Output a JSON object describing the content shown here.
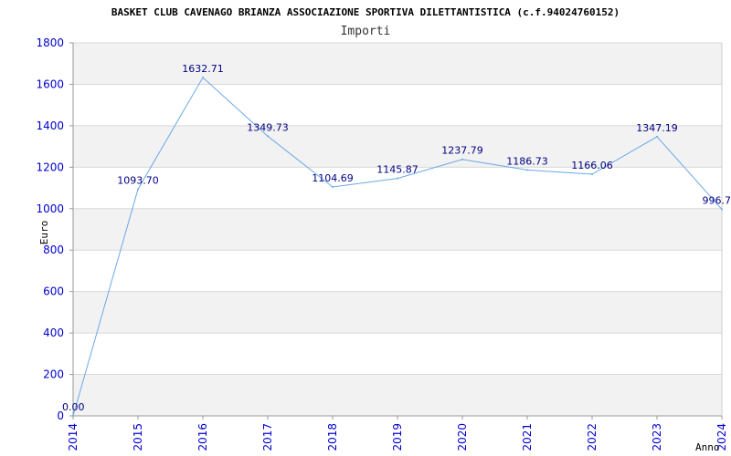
{
  "chart_data": {
    "type": "line",
    "title": "BASKET CLUB CAVENAGO BRIANZA ASSOCIAZIONE SPORTIVA DILETTANTISTICA (c.f.94024760152)",
    "subtitle": "Importi",
    "xlabel": "Anno",
    "ylabel": "Euro",
    "categories": [
      "2014",
      "2015",
      "2016",
      "2017",
      "2018",
      "2019",
      "2020",
      "2021",
      "2022",
      "2023",
      "2024"
    ],
    "series": [
      {
        "values": [
          0,
          1093.7,
          1632.71,
          1349.73,
          1104.69,
          1145.87,
          1237.79,
          1186.73,
          1166.06,
          1347.19,
          996.7
        ],
        "labels": [
          "0.00",
          "1093.70",
          "1632.71",
          "1349.73",
          "1104.69",
          "1145.87",
          "1237.79",
          "1186.73",
          "1166.06",
          "1347.19",
          "996.7"
        ]
      }
    ],
    "ylim": [
      0,
      1800
    ],
    "yticks": [
      "0",
      "200",
      "400",
      "600",
      "800",
      "1000",
      "1200",
      "1400",
      "1600",
      "1800"
    ],
    "grid": true,
    "colors": {
      "line": "#6aa9e6",
      "axis_text": "#0000cc",
      "data_label": "#000080",
      "band": "#f2f2f2",
      "grid": "#d8d8d8"
    }
  }
}
